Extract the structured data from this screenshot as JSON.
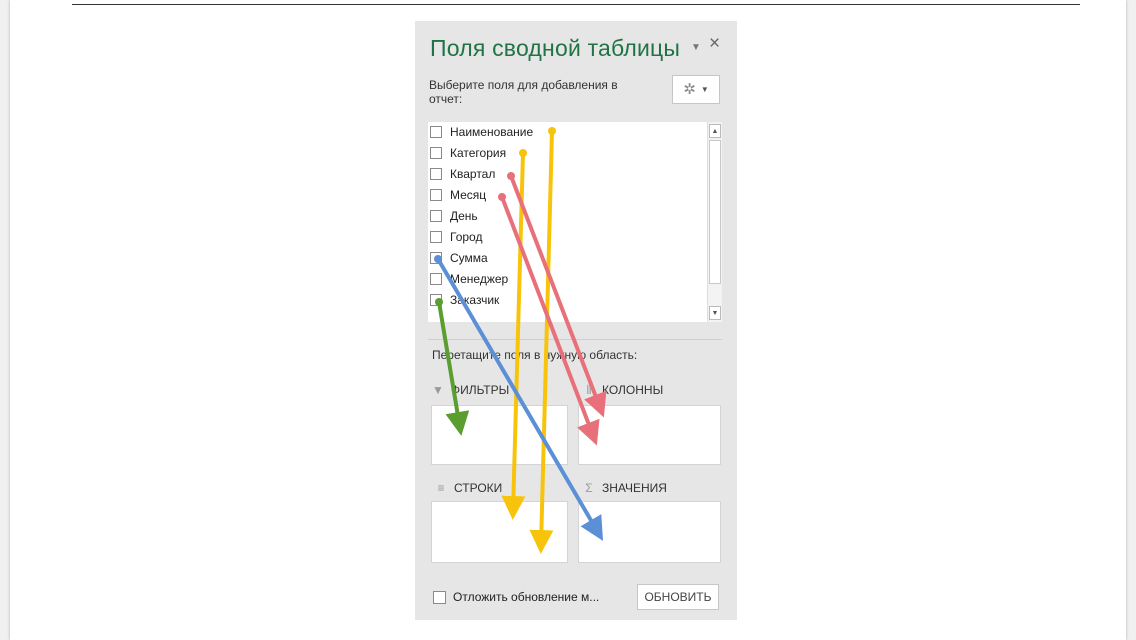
{
  "pane": {
    "title": "Поля сводной таблицы",
    "menu_icon": "dropdown-caret-icon",
    "close_glyph": "×",
    "choose_label": "Выберите поля для добавления в отчет:",
    "tools_icon": "gear-icon"
  },
  "fields": [
    {
      "label": "Наименование",
      "checked": false
    },
    {
      "label": "Категория",
      "checked": false
    },
    {
      "label": "Квартал",
      "checked": false
    },
    {
      "label": "Месяц",
      "checked": false
    },
    {
      "label": "День",
      "checked": false
    },
    {
      "label": "Город",
      "checked": false
    },
    {
      "label": "Сумма",
      "checked": true
    },
    {
      "label": "Менеджер",
      "checked": false
    },
    {
      "label": "Заказчик",
      "checked": true
    }
  ],
  "areas": {
    "drag_label": "Перетащите поля в нужную область:",
    "filters": "ФИЛЬТРЫ",
    "columns": "КОЛОННЫ",
    "rows": "СТРОКИ",
    "values": "ЗНАЧЕНИЯ",
    "values_glyph": "Σ"
  },
  "footer": {
    "defer_label": "Отложить обновление м...",
    "update_button": "ОБНОВИТЬ"
  },
  "colors": {
    "title_green": "#217346",
    "arrow_yellow": "#f7c40b",
    "arrow_red": "#e8707a",
    "arrow_blue": "#5b8fd6",
    "arrow_green": "#5a9e2f"
  }
}
